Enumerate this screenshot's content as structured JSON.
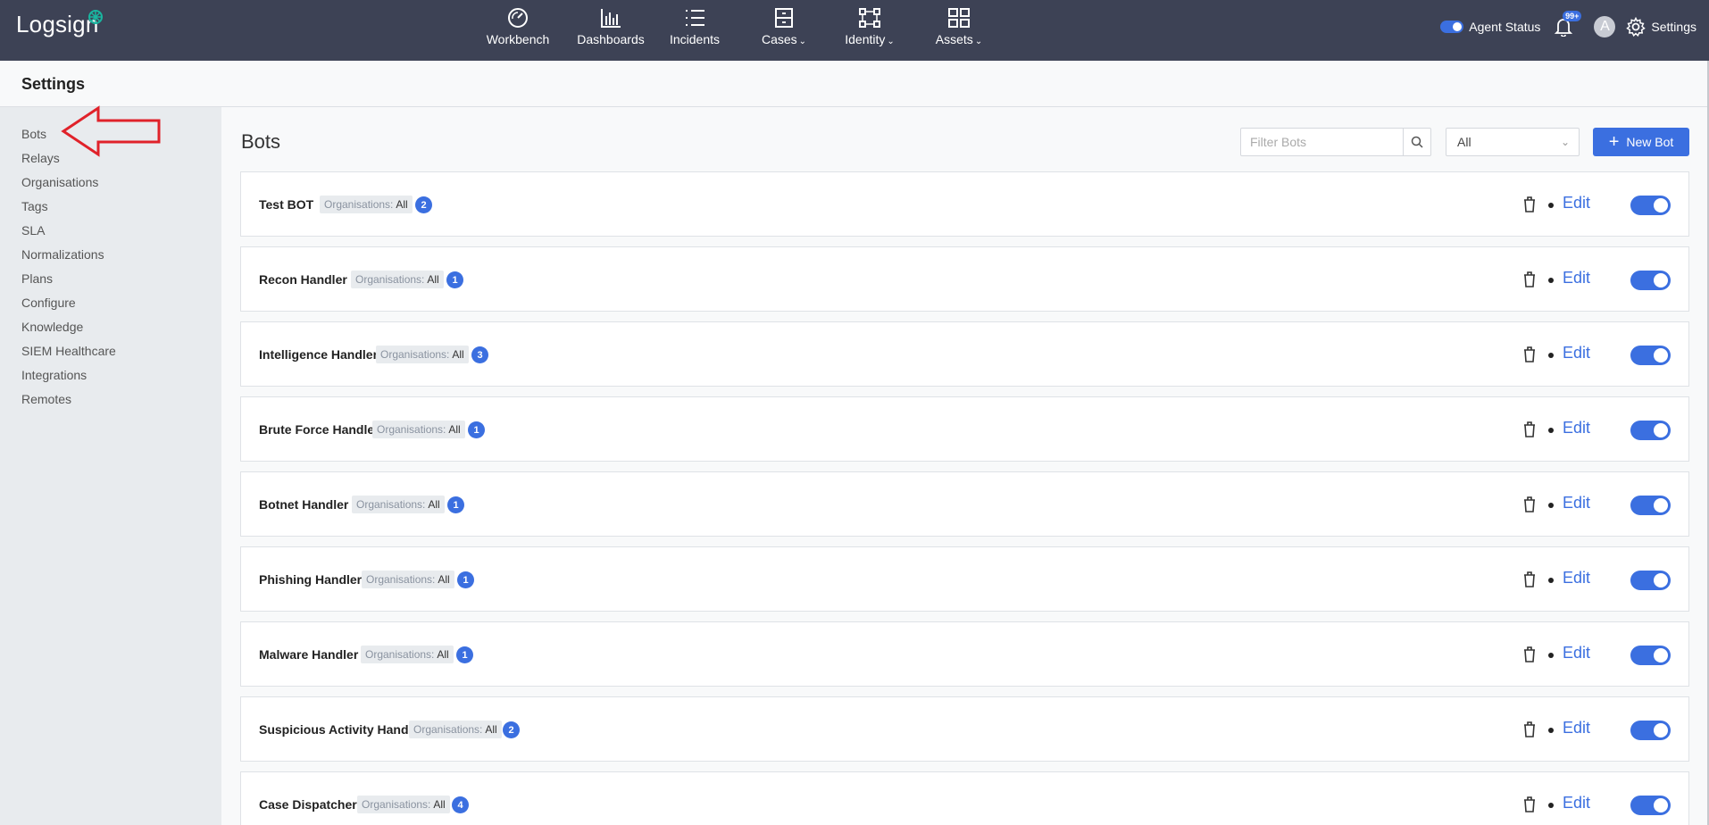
{
  "topbar": {
    "logo": "Logsign",
    "nav": [
      {
        "label": "Workbench",
        "icon": "gauge-icon",
        "dropdown": false
      },
      {
        "label": "Dashboards",
        "icon": "bar-chart-icon",
        "dropdown": false
      },
      {
        "label": "Incidents",
        "icon": "list-icon",
        "dropdown": false
      },
      {
        "label": "Cases",
        "icon": "cabinet-icon",
        "dropdown": true
      },
      {
        "label": "Identity",
        "icon": "identity-icon",
        "dropdown": true
      },
      {
        "label": "Assets",
        "icon": "assets-icon",
        "dropdown": true
      }
    ],
    "agent_status_label": "Agent Status",
    "notifications_badge": "99+",
    "avatar_initial": "A",
    "settings_label": "Settings"
  },
  "page": {
    "title": "Settings"
  },
  "sidebar": {
    "items": [
      "Bots",
      "Relays",
      "Organisations",
      "Tags",
      "SLA",
      "Normalizations",
      "Plans",
      "Configure",
      "Knowledge",
      "SIEM Healthcare",
      "Integrations",
      "Remotes"
    ]
  },
  "main": {
    "title": "Bots",
    "filter_placeholder": "Filter Bots",
    "select_value": "All",
    "new_bot_label": "New Bot",
    "org_label": "Organisations:",
    "edit_label": "Edit",
    "bots": [
      {
        "name": "Test BOT",
        "org": "All",
        "count": "2",
        "enabled": true
      },
      {
        "name": "Recon Handler",
        "org": "All",
        "count": "1",
        "enabled": true
      },
      {
        "name": "Intelligence Handler",
        "org": "All",
        "count": "3",
        "enabled": true
      },
      {
        "name": "Brute Force Handler",
        "org": "All",
        "count": "1",
        "enabled": true
      },
      {
        "name": "Botnet Handler",
        "org": "All",
        "count": "1",
        "enabled": true
      },
      {
        "name": "Phishing Handler",
        "org": "All",
        "count": "1",
        "enabled": true
      },
      {
        "name": "Malware Handler",
        "org": "All",
        "count": "1",
        "enabled": true
      },
      {
        "name": "Suspicious Activity Handler",
        "org": "All",
        "count": "2",
        "enabled": true
      },
      {
        "name": "Case Dispatcher",
        "org": "All",
        "count": "4",
        "enabled": true
      }
    ]
  },
  "colors": {
    "topbar": "#3d4255",
    "accent": "#3b6fe0",
    "sidebar": "#e8ebee",
    "annotation_arrow": "#e0222a"
  }
}
